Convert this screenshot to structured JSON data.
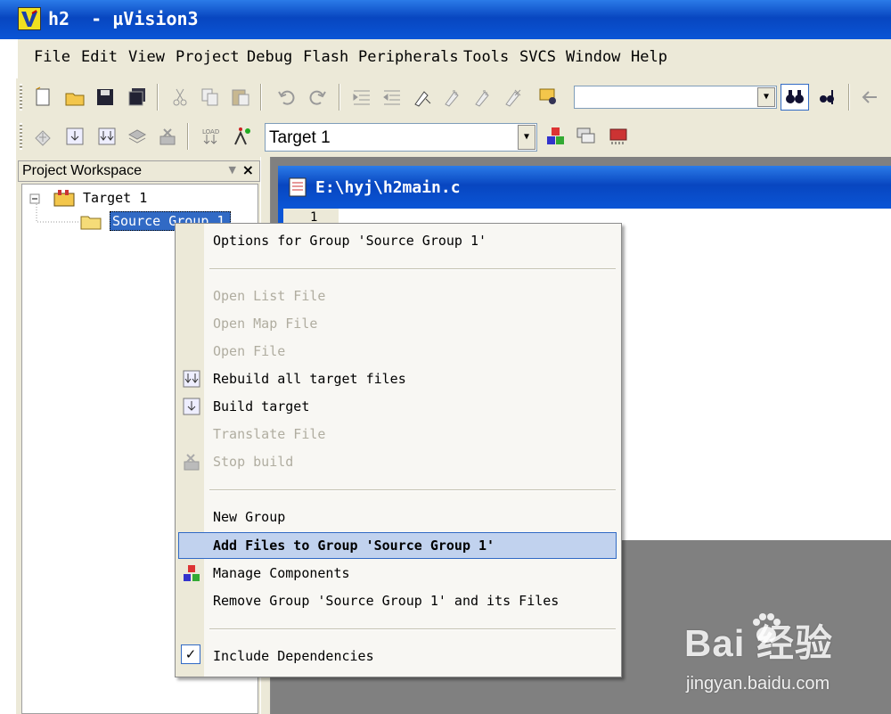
{
  "window": {
    "title": "h2  - µVision3"
  },
  "menu": {
    "items": [
      {
        "label": "File"
      },
      {
        "label": "Edit"
      },
      {
        "label": "View"
      },
      {
        "label": "Project"
      },
      {
        "label": "Debug"
      },
      {
        "label": "Flash"
      },
      {
        "label": "Peripherals"
      },
      {
        "label": "Tools"
      },
      {
        "label": "SVCS"
      },
      {
        "label": "Window"
      },
      {
        "label": "Help"
      }
    ]
  },
  "toolbar": {
    "find_value": "",
    "target_value": "Target 1"
  },
  "workspace": {
    "title": "Project Workspace",
    "close": "×",
    "tree": {
      "root": "Target 1",
      "group": "Source Group 1"
    }
  },
  "editor": {
    "title": "E:\\hyj\\h2main.c",
    "line_number": "1"
  },
  "context_menu": {
    "items": [
      {
        "label": "Options for Group 'Source Group 1'",
        "enabled": true
      },
      {
        "label": "Open List File",
        "enabled": false
      },
      {
        "label": "Open Map File",
        "enabled": false
      },
      {
        "label": "Open File",
        "enabled": false
      },
      {
        "label": "Rebuild all target files",
        "enabled": true,
        "icon": "rebuild-icon"
      },
      {
        "label": "Build target",
        "enabled": true,
        "icon": "build-icon"
      },
      {
        "label": "Translate File",
        "enabled": false
      },
      {
        "label": "Stop build",
        "enabled": false,
        "icon": "stop-build-icon"
      },
      {
        "label": "New Group",
        "enabled": true
      },
      {
        "label": "Add Files to Group 'Source Group 1'",
        "enabled": true,
        "highlighted": true
      },
      {
        "label": "Manage Components",
        "enabled": true,
        "icon": "components-icon"
      },
      {
        "label": "Remove Group 'Source Group 1' and its Files",
        "enabled": true
      },
      {
        "label": "Include Dependencies",
        "enabled": true,
        "checked": true
      }
    ]
  },
  "watermark": {
    "brand": "Bai    经验",
    "site": "jingyan.baidu.com"
  },
  "colors": {
    "titlebar": "#0a55d6",
    "chrome": "#ece9d8",
    "highlight": "#c1d2ee"
  }
}
